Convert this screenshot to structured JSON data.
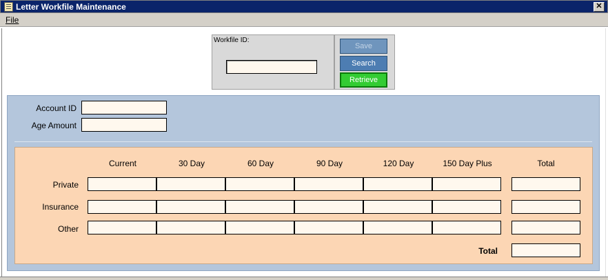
{
  "window": {
    "title": "Letter Workfile Maintenance",
    "close_glyph": "✕"
  },
  "menu": {
    "file_label": "File"
  },
  "workfile": {
    "label": "Workfile ID:",
    "value": ""
  },
  "buttons": {
    "save_label": "Save",
    "search_label": "Search",
    "retrieve_label": "Retrieve"
  },
  "account": {
    "account_id_label": "Account ID",
    "account_id_value": "",
    "age_amount_label": "Age Amount",
    "age_amount_value": ""
  },
  "aging": {
    "columns": [
      "Current",
      "30 Day",
      "60 Day",
      "90 Day",
      "120 Day",
      "150 Day Plus",
      "Total"
    ],
    "rows": [
      "Private",
      "Insurance",
      "Other"
    ],
    "grand_total_label": "Total"
  },
  "colors": {
    "titlebar": "#0a246a",
    "account_panel": "#b4c6dc",
    "aging_panel": "#fcd6b4",
    "field_bg": "#fff8ee",
    "retrieve_button": "#33cc33",
    "search_button": "#4d7db2"
  },
  "icons": {
    "app": "document-icon",
    "close": "close-icon"
  }
}
